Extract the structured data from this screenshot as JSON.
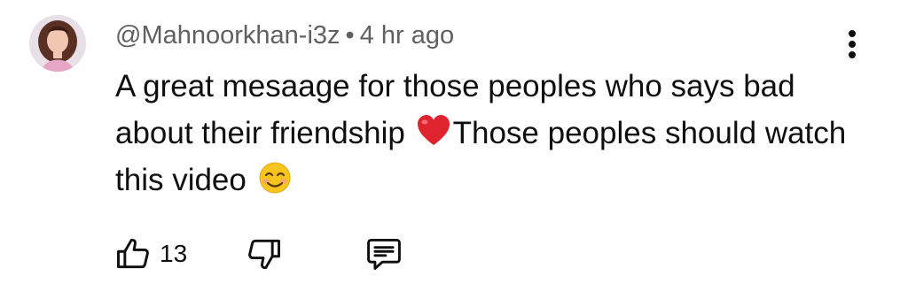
{
  "comment": {
    "author": "@Mahnoorkhan-i3z",
    "separator": "•",
    "time": "4 hr ago",
    "text_part1": "A great mesaage for those peoples who says bad about their friendship",
    "text_part2": "Those peoples should watch this video",
    "emoji1": "red-heart",
    "emoji2": "smiling-face",
    "like_count": "13"
  },
  "icons": {
    "avatar": "user-avatar",
    "menu": "more-vertical-icon",
    "like": "thumbs-up-icon",
    "dislike": "thumbs-down-icon",
    "reply": "reply-comment-icon"
  },
  "colors": {
    "text": "#0f0f0f",
    "meta": "#606060",
    "heart": "#e0242f",
    "emoji_face": "#f7c51e"
  }
}
